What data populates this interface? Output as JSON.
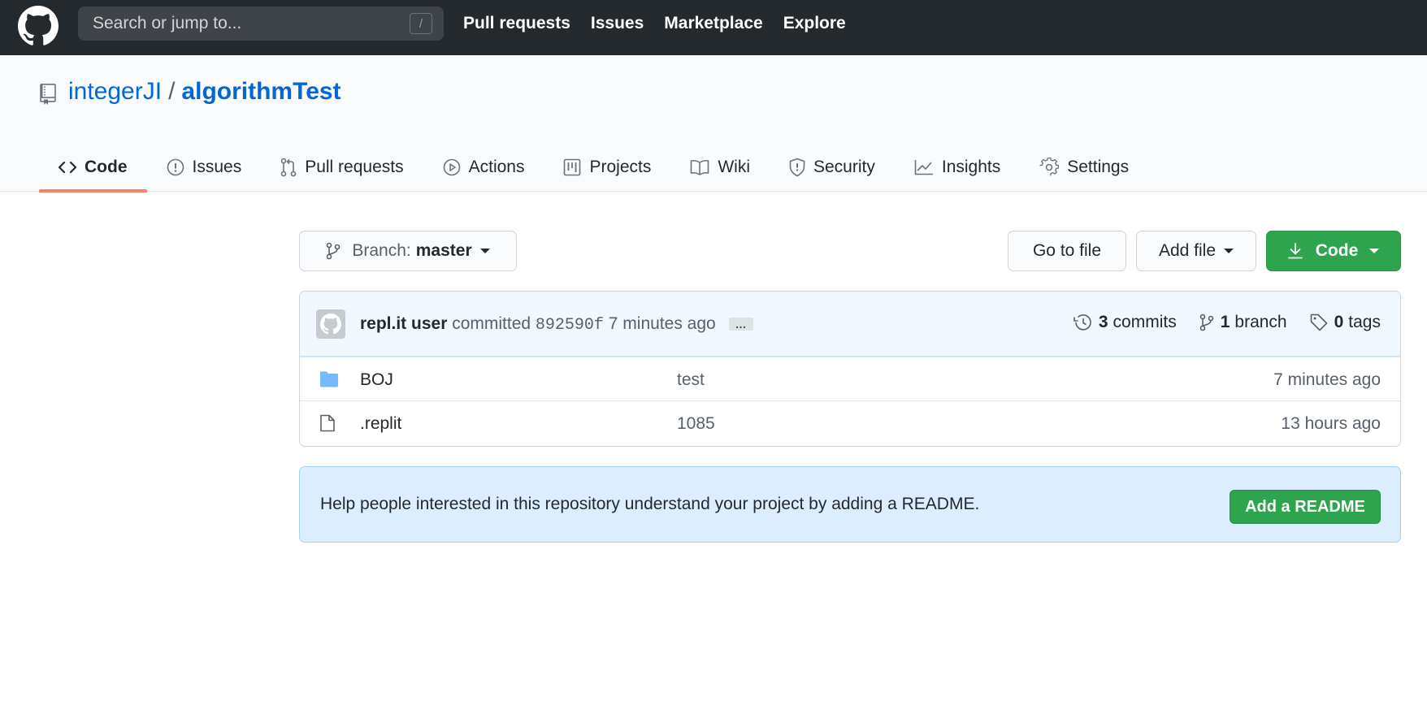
{
  "header": {
    "logo": "github-octocat-icon",
    "search_placeholder": "Search or jump to...",
    "search_shortcut": "/",
    "nav": [
      "Pull requests",
      "Issues",
      "Marketplace",
      "Explore"
    ]
  },
  "repo": {
    "owner": "integerJI",
    "separator": "/",
    "name": "algorithmTest",
    "tabs": [
      {
        "label": "Code",
        "icon": "code-icon",
        "active": true
      },
      {
        "label": "Issues",
        "icon": "issue-icon"
      },
      {
        "label": "Pull requests",
        "icon": "pull-request-icon"
      },
      {
        "label": "Actions",
        "icon": "play-icon"
      },
      {
        "label": "Projects",
        "icon": "project-icon"
      },
      {
        "label": "Wiki",
        "icon": "book-icon"
      },
      {
        "label": "Security",
        "icon": "shield-icon"
      },
      {
        "label": "Insights",
        "icon": "graph-icon"
      },
      {
        "label": "Settings",
        "icon": "gear-icon"
      }
    ]
  },
  "toolbar": {
    "branch_label": "Branch:",
    "branch_name": "master",
    "go_to_file": "Go to file",
    "add_file": "Add file",
    "code": "Code"
  },
  "commit": {
    "user": "repl.it user",
    "verb": "committed",
    "sha": "892590f",
    "time": "7 minutes ago",
    "ellipsis": "…",
    "commits_count": "3",
    "commits_label": "commits",
    "branch_count": "1",
    "branch_label": "branch",
    "tags_count": "0",
    "tags_label": "tags"
  },
  "files": [
    {
      "type": "folder",
      "name": "BOJ",
      "message": "test",
      "age": "7 minutes ago"
    },
    {
      "type": "file",
      "name": ".replit",
      "message": "1085",
      "age": "13 hours ago"
    }
  ],
  "readme": {
    "text": "Help people interested in this repository understand your project by adding a README.",
    "button": "Add a README"
  },
  "colors": {
    "header_bg": "#24292e",
    "link": "#0366d6",
    "primary_green": "#2ea44f",
    "active_tab_underline": "#f9826c"
  }
}
